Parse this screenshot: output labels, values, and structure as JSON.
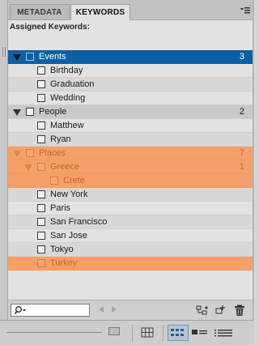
{
  "tabs": [
    {
      "label": "METADATA",
      "active": false
    },
    {
      "label": "KEYWORDS",
      "active": true
    }
  ],
  "assigned_label": "Assigned Keywords:",
  "keywords": [
    {
      "label": "Events",
      "level": 0,
      "expanded": true,
      "count": "3",
      "state": "selected"
    },
    {
      "label": "Birthday",
      "level": 1,
      "state": "normal"
    },
    {
      "label": "Graduation",
      "level": 1,
      "state": "normal"
    },
    {
      "label": "Wedding",
      "level": 1,
      "state": "normal"
    },
    {
      "label": "People",
      "level": 0,
      "expanded": true,
      "count": "2",
      "state": "normal"
    },
    {
      "label": "Matthew",
      "level": 1,
      "state": "normal"
    },
    {
      "label": "Ryan",
      "level": 1,
      "state": "normal"
    },
    {
      "label": "Places",
      "level": 0,
      "expanded": true,
      "count": "7",
      "state": "highlight"
    },
    {
      "label": "Greece",
      "level": 1,
      "expanded": true,
      "count": "1",
      "state": "highlight"
    },
    {
      "label": "Crete",
      "level": 2,
      "state": "highlight"
    },
    {
      "label": "New York",
      "level": 1,
      "state": "normal"
    },
    {
      "label": "Paris",
      "level": 1,
      "state": "normal"
    },
    {
      "label": "San Francisco",
      "level": 1,
      "state": "normal"
    },
    {
      "label": "San Jose",
      "level": 1,
      "state": "normal"
    },
    {
      "label": "Tokyo",
      "level": 1,
      "state": "normal"
    },
    {
      "label": "Turkey",
      "level": 1,
      "state": "highlight"
    }
  ],
  "search": {
    "value": "",
    "placeholder": ""
  },
  "icons": {
    "panel_menu": "panel-menu-icon",
    "search": "search-icon",
    "prev": "arrow-left-icon",
    "next": "arrow-right-icon",
    "new_sub_keyword": "new-sub-keyword-icon",
    "new_keyword": "new-keyword-icon",
    "delete": "trash-icon",
    "grid_view": "grid-view-icon",
    "thumbnail_view": "thumbnail-view-icon",
    "list_view": "list-view-icon",
    "detail_view": "detail-view-icon"
  },
  "colors": {
    "selected": "#0a5fa5",
    "highlight": "#f5a06a",
    "highlight_text": "#c9662b"
  }
}
